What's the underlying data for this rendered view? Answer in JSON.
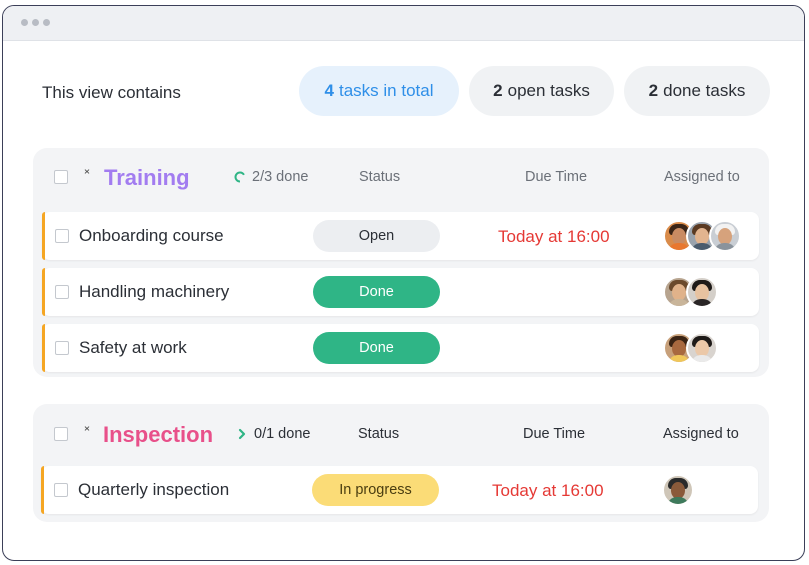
{
  "summary": {
    "label": "This view contains",
    "total_count": "4",
    "total_text": "tasks in total",
    "open_count": "2",
    "open_text": "open tasks",
    "done_count": "2",
    "done_text": "done tasks"
  },
  "columns": {
    "status": "Status",
    "due": "Due Time",
    "assigned": "Assigned to"
  },
  "groups": [
    {
      "title": "Training",
      "title_color": "#a27cf0",
      "progress": "2/3 done",
      "tasks": [
        {
          "name": "Onboarding course",
          "status": "Open",
          "due": "Today at 16:00",
          "avatars": [
            "person-avatar",
            "person-avatar",
            "person-avatar"
          ]
        },
        {
          "name": "Handling machinery",
          "status": "Done",
          "due": "",
          "avatars": [
            "person-avatar",
            "person-avatar"
          ]
        },
        {
          "name": "Safety at work",
          "status": "Done",
          "due": "",
          "avatars": [
            "person-avatar",
            "person-avatar"
          ]
        }
      ]
    },
    {
      "title": "Inspection",
      "title_color": "#e8508a",
      "progress": "0/1 done",
      "tasks": [
        {
          "name": "Quarterly inspection",
          "status": "In progress",
          "due": "Today at 16:00",
          "avatars": [
            "person-avatar"
          ]
        }
      ]
    }
  ],
  "colors": {
    "accent_blue": "#2f8fe8",
    "done_green": "#2fb586",
    "progress_yellow": "#fbdc77",
    "due_red": "#e53935",
    "row_marker": "#f5a623"
  }
}
